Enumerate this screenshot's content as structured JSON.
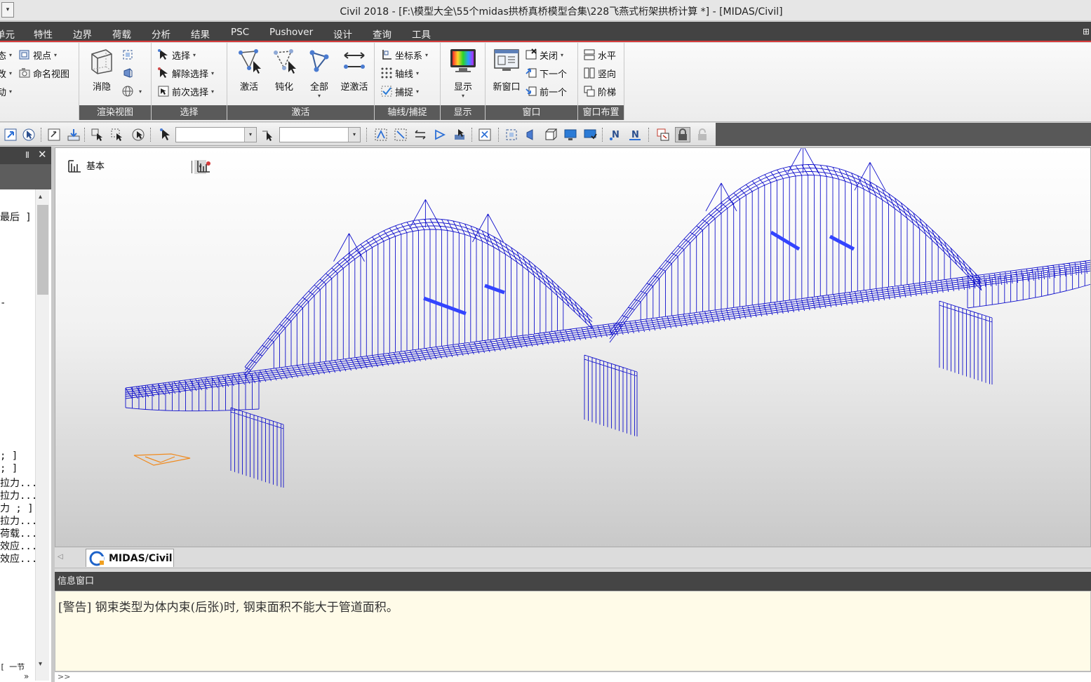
{
  "window": {
    "title": "Civil 2018 - [F:\\模型大全\\55个midas拱桥真桥模型合集\\228飞燕式桁架拱桥计算 *] - [MIDAS/Civil]",
    "system_menu_glyph": "▾"
  },
  "menubar": {
    "items": [
      "单元",
      "特性",
      "边界",
      "荷载",
      "分析",
      "结果",
      "PSC",
      "Pushover",
      "设计",
      "查询",
      "工具"
    ],
    "pin_glyph": "⊞"
  },
  "ribbon": {
    "partial_group": {
      "items": [
        "态",
        "改",
        "动"
      ]
    },
    "view_group": {
      "viewpoint": "视点",
      "named_view": "命名视图"
    },
    "render_group": {
      "label": "渲染视图",
      "hide": "消隐"
    },
    "select_group": {
      "label": "选择",
      "select": "选择",
      "deselect": "解除选择",
      "previous": "前次选择"
    },
    "activate_group": {
      "label": "激活",
      "activate": "激活",
      "deactivate": "钝化",
      "all": "全部",
      "inverse": "逆激活"
    },
    "grid_group": {
      "label": "轴线/捕捉",
      "coord": "坐标系",
      "grid": "轴线",
      "snap": "捕捉"
    },
    "display_group": {
      "label": "显示",
      "display": "显示"
    },
    "window_group": {
      "label": "窗口",
      "new_window": "新窗口",
      "close": "关闭",
      "next": "下一个",
      "prev": "前一个"
    },
    "layout_group": {
      "label": "窗口布置",
      "horizontal": "水平",
      "vertical": "竖向",
      "cascade": "阶梯"
    },
    "dropdown_glyph": "▾"
  },
  "toolbar": {
    "combo_arrow": "▾"
  },
  "left_panel": {
    "pin": "Ⅱ",
    "close": "✕",
    "scroll_up": "▴",
    "scroll_down": "▾",
    "more": "»",
    "lines": [
      "最后 ]",
      "-",
      "; ]",
      "; ]",
      "拉力...",
      "拉力...",
      "力 ; ]",
      "拉力...",
      "荷载...",
      "效应...",
      "效应...",
      "[ 一节"
    ]
  },
  "viewport": {
    "view_mode": "基本",
    "combo_arrow": "▾"
  },
  "colors": {
    "model": "#1111cc",
    "model_highlight": "#3344ff",
    "axis_marker": "#f08a1e",
    "menubar_bg": "#434343",
    "accent_line": "#d53a3a"
  },
  "tabs": [
    {
      "label": "MIDAS/Civil",
      "active": true
    }
  ],
  "tab_scroll": "◁",
  "message_window": {
    "title": "信息窗口",
    "lines": [
      "[警告] 钢束类型为体内束(后张)时, 钢束面积不能大于管道面积。"
    ],
    "prompt": ">>"
  }
}
